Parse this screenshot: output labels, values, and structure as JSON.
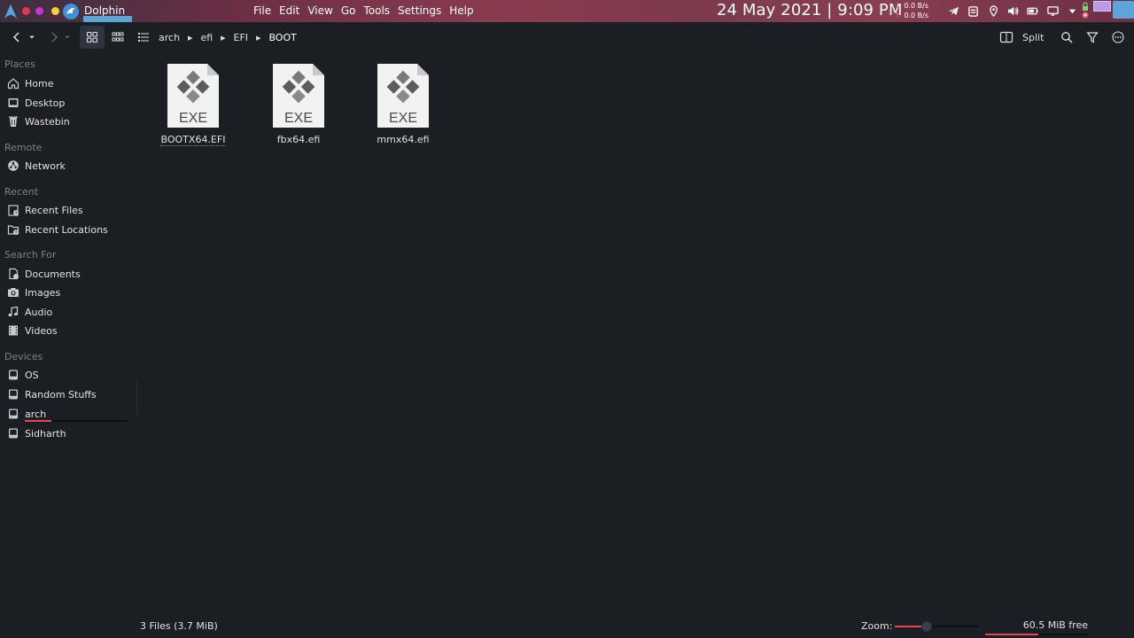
{
  "window": {
    "title": "Dolphin"
  },
  "menu": [
    "File",
    "Edit",
    "View",
    "Go",
    "Tools",
    "Settings",
    "Help"
  ],
  "panel": {
    "clock": "24 May 2021 | 9:09 PM",
    "net_down": "0.0 B/s",
    "net_up": "0.0 B/s",
    "tray_icons": [
      "telegram-icon",
      "clipboard-icon",
      "location-icon",
      "volume-icon",
      "battery-icon",
      "display-icon",
      "expand-icon",
      "pomodoro-icon",
      "pager-icon"
    ]
  },
  "toolbar": {
    "breadcrumb": [
      "arch",
      "efi",
      "EFI",
      "BOOT"
    ],
    "split_label": "Split",
    "active_view": "icons"
  },
  "sidebar": {
    "sections": {
      "places": "Places",
      "remote": "Remote",
      "recent": "Recent",
      "search": "Search For",
      "devices": "Devices"
    },
    "places": [
      "Home",
      "Desktop",
      "Wastebin"
    ],
    "remote": [
      "Network"
    ],
    "recent": [
      "Recent Files",
      "Recent Locations"
    ],
    "search": [
      "Documents",
      "Images",
      "Audio",
      "Videos"
    ],
    "devices": [
      "OS",
      "Random Stuffs",
      "arch",
      "Sidharth"
    ],
    "arch_usage_fraction": 0.26
  },
  "files": [
    {
      "name": "BOOTX64.EFI",
      "badge": "EXE",
      "selected_focus": true
    },
    {
      "name": "fbx64.efi",
      "badge": "EXE"
    },
    {
      "name": "mmx64.efi",
      "badge": "EXE"
    }
  ],
  "status": {
    "summary": "3 Files (3.7 MiB)",
    "zoom_label": "Zoom:",
    "zoom_fraction": 0.38,
    "free_label": "60.5 MiB free",
    "used_fraction": 0.52
  },
  "colors": {
    "accent": "#e64553",
    "background": "#1b1e23",
    "text": "#dfe1e4",
    "muted": "#7d8189"
  }
}
